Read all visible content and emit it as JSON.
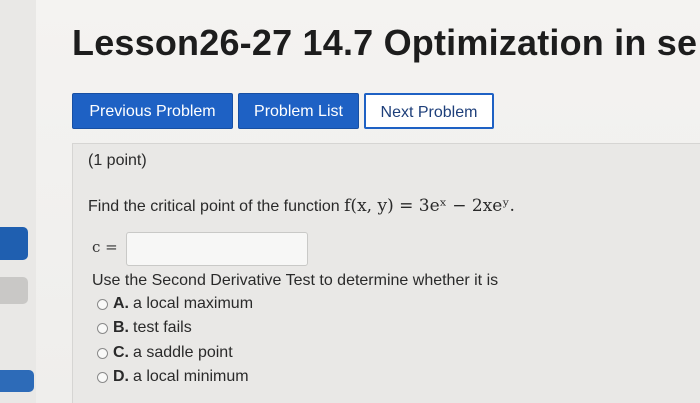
{
  "header": {
    "title": "Lesson26-27 14.7 Optimization in se"
  },
  "nav": {
    "previous_label": "Previous Problem",
    "list_label": "Problem List",
    "next_label": "Next Problem"
  },
  "problem": {
    "points": "(1 point)",
    "prompt_text": "Find the critical point of the function ",
    "function_text": "f(x, y) = 3eˣ − 2xeʸ.",
    "answer_label": "c =",
    "answer_value": "",
    "instruction": "Use the Second Derivative Test to determine whether it is",
    "options": [
      {
        "letter": "A.",
        "text": "a local maximum"
      },
      {
        "letter": "B.",
        "text": "test fails"
      },
      {
        "letter": "C.",
        "text": "a saddle point"
      },
      {
        "letter": "D.",
        "text": "a local minimum"
      }
    ]
  },
  "colors": {
    "button_blue": "#1e61c4",
    "edge_blue": "#1f5fb0",
    "background": "#f2f1ef"
  }
}
